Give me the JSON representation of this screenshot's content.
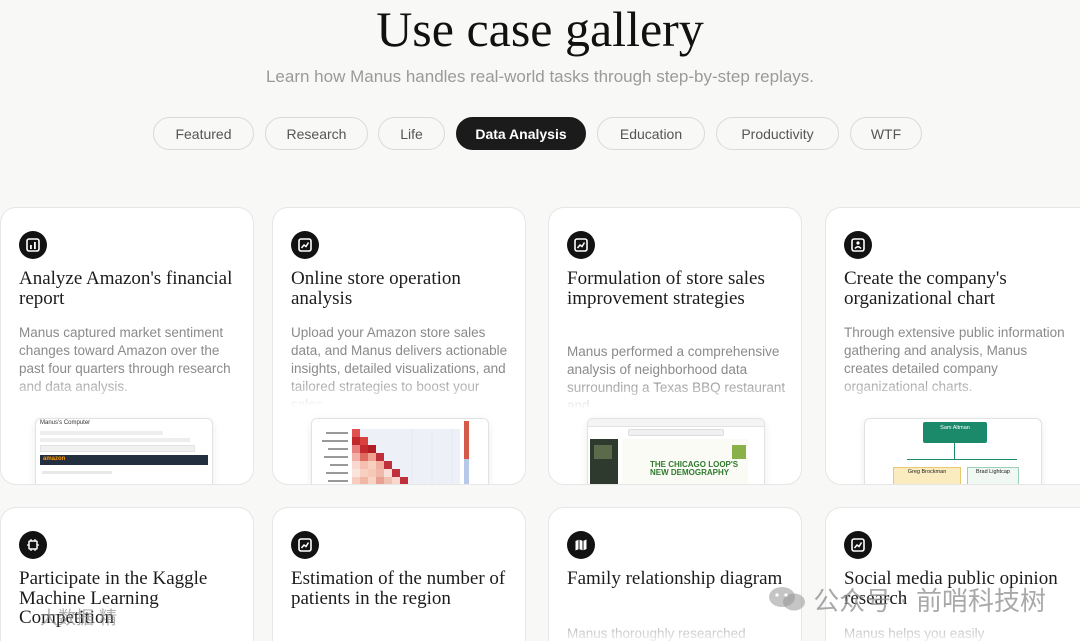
{
  "header": {
    "title": "Use case gallery",
    "subtitle": "Learn how Manus handles real-world tasks through step-by-step replays."
  },
  "tabs": [
    {
      "label": "Featured",
      "active": false
    },
    {
      "label": "Research",
      "active": false
    },
    {
      "label": "Life",
      "active": false
    },
    {
      "label": "Data Analysis",
      "active": true
    },
    {
      "label": "Education",
      "active": false
    },
    {
      "label": "Productivity",
      "active": false
    },
    {
      "label": "WTF",
      "active": false
    }
  ],
  "cards": [
    {
      "icon": "chart-box-icon",
      "title": "Analyze Amazon's financial report",
      "description": "Manus captured market sentiment changes toward Amazon over the past four quarters through research and data analysis.",
      "thumb": {
        "header": "Manus's Computer",
        "brand": "amazon"
      }
    },
    {
      "icon": "chart-box-icon",
      "title": "Online store operation analysis",
      "description": "Upload your Amazon store sales data, and Manus delivers actionable insights, detailed visualizations, and tailored strategies to boost your sales."
    },
    {
      "icon": "chart-box-icon",
      "title": "Formulation of store sales improvement strategies",
      "description": "Manus performed a comprehensive analysis of neighborhood data surrounding a Texas BBQ restaurant and",
      "thumb": {
        "headline_1": "THE CHICAGO LOOP'S",
        "headline_2": "NEW DEMOGRAPHY"
      }
    },
    {
      "icon": "org-chart-icon",
      "title": "Create the company's organizational chart",
      "description": "Through extensive public information gathering and analysis, Manus creates detailed company organizational charts.",
      "thumb": {
        "top_name": "Sam Altman",
        "left_name": "Greg Brockman",
        "right_name": "Brad Lightcap"
      }
    },
    {
      "icon": "chip-icon",
      "title": "Participate in the Kaggle Machine Learning Competition",
      "description": ""
    },
    {
      "icon": "chart-box-icon",
      "title": "Estimation of the number of patients in the region",
      "description": ""
    },
    {
      "icon": "map-icon",
      "title": "Family relationship diagram",
      "description": "Manus thoroughly researched"
    },
    {
      "icon": "chart-box-icon",
      "title": "Social media public opinion research",
      "description": "Manus helps you easily"
    }
  ],
  "watermark": {
    "text": "公众号 · 前哨科技树",
    "left": "大数据 精"
  },
  "colors": {
    "accent_dark": "#1b1b1b",
    "background": "#f8f8f7",
    "heatmap_red": "#c9302c",
    "org_green": "#1b8a6b"
  }
}
